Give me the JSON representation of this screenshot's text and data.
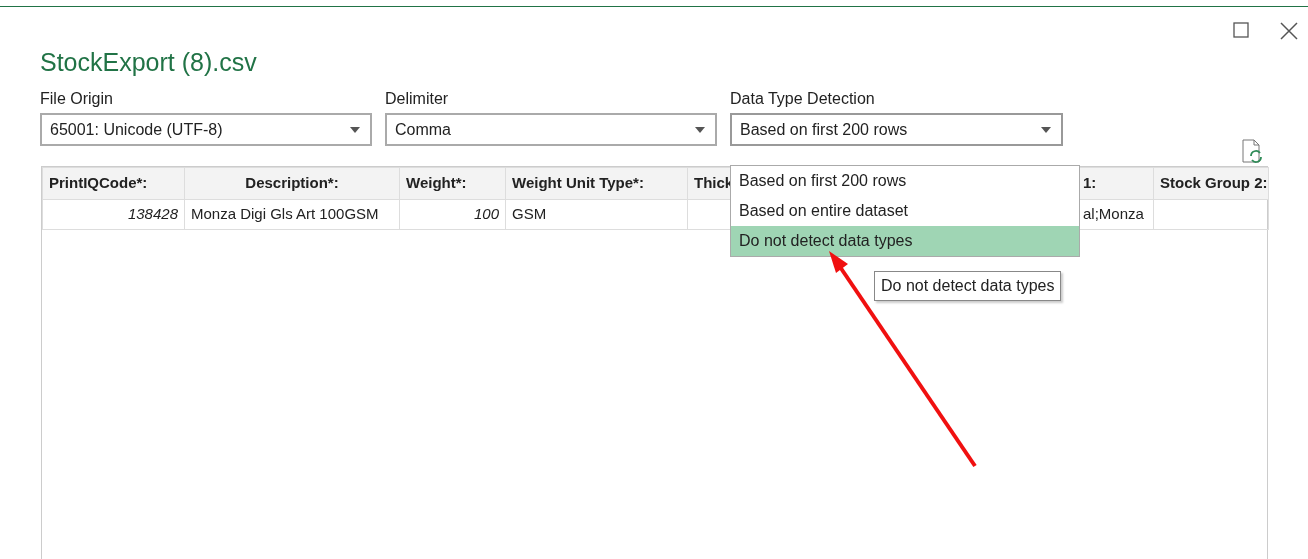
{
  "window": {
    "title": "StockExport (8).csv"
  },
  "fields": [
    {
      "label": "File Origin",
      "value": "65001: Unicode (UTF-8)"
    },
    {
      "label": "Delimiter",
      "value": "Comma"
    },
    {
      "label": "Data Type Detection",
      "value": "Based on first 200 rows",
      "expanded": true
    }
  ],
  "dropdown": {
    "options": [
      {
        "label": "Based on first 200 rows",
        "selected": false
      },
      {
        "label": "Based on entire dataset",
        "selected": false
      },
      {
        "label": "Do not detect data types",
        "selected": true
      }
    ],
    "tooltip": "Do not detect data types"
  },
  "table": {
    "columns": [
      "PrintIQCode*:",
      "Description*:",
      "Weight*:",
      "Weight Unit Type*:",
      "Thick",
      "1:",
      "Stock Group 2:"
    ],
    "rows": [
      [
        "138428",
        "Monza Digi Gls Art 100GSM",
        "100",
        "GSM",
        "",
        "al;Monza",
        ""
      ]
    ]
  }
}
